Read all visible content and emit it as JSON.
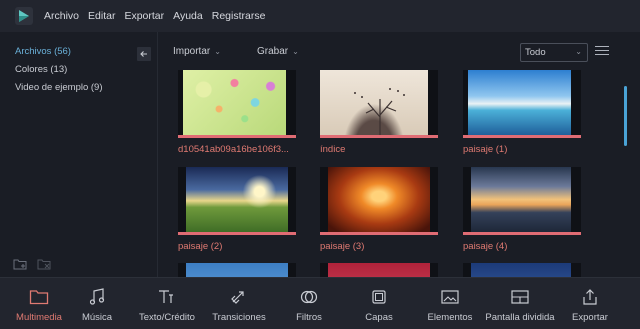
{
  "menubar": {
    "items": [
      "Archivo",
      "Editar",
      "Exportar",
      "Ayuda",
      "Registrarse"
    ]
  },
  "sidebar": {
    "items": [
      {
        "label": "Archivos (56)",
        "active": true
      },
      {
        "label": "Colores (13)",
        "active": false
      },
      {
        "label": "Video de ejemplo (9)",
        "active": false
      }
    ],
    "footer_icons": [
      "add-folder-icon",
      "delete-folder-icon"
    ],
    "collapse_icon": "arrow-left-icon"
  },
  "toolbar": {
    "import_label": "Importar",
    "record_label": "Grabar",
    "sort_value": "Todo",
    "view_icon": "list-view-icon"
  },
  "media": [
    {
      "label": "d10541ab09a16be106f3..."
    },
    {
      "label": "índice"
    },
    {
      "label": "paisaje (1)"
    },
    {
      "label": "paisaje (2)"
    },
    {
      "label": "paisaje (3)"
    },
    {
      "label": "paisaje (4)"
    }
  ],
  "tabs": [
    {
      "label": "Multimedia",
      "icon": "folder-icon",
      "active": true
    },
    {
      "label": "Música",
      "icon": "music-note-icon",
      "active": false
    },
    {
      "label": "Texto/Crédito",
      "icon": "text-icon",
      "active": false
    },
    {
      "label": "Transiciones",
      "icon": "transition-icon",
      "active": false
    },
    {
      "label": "Filtros",
      "icon": "filter-icon",
      "active": false
    },
    {
      "label": "Capas",
      "icon": "layers-icon",
      "active": false
    },
    {
      "label": "Elementos",
      "icon": "image-icon",
      "active": false
    },
    {
      "label": "Pantalla dividida",
      "icon": "split-screen-icon",
      "active": false
    },
    {
      "label": "Exportar",
      "icon": "export-icon",
      "active": false
    }
  ],
  "colors": {
    "accent": "#e07a72",
    "selection_blue": "#6ab0d8"
  }
}
